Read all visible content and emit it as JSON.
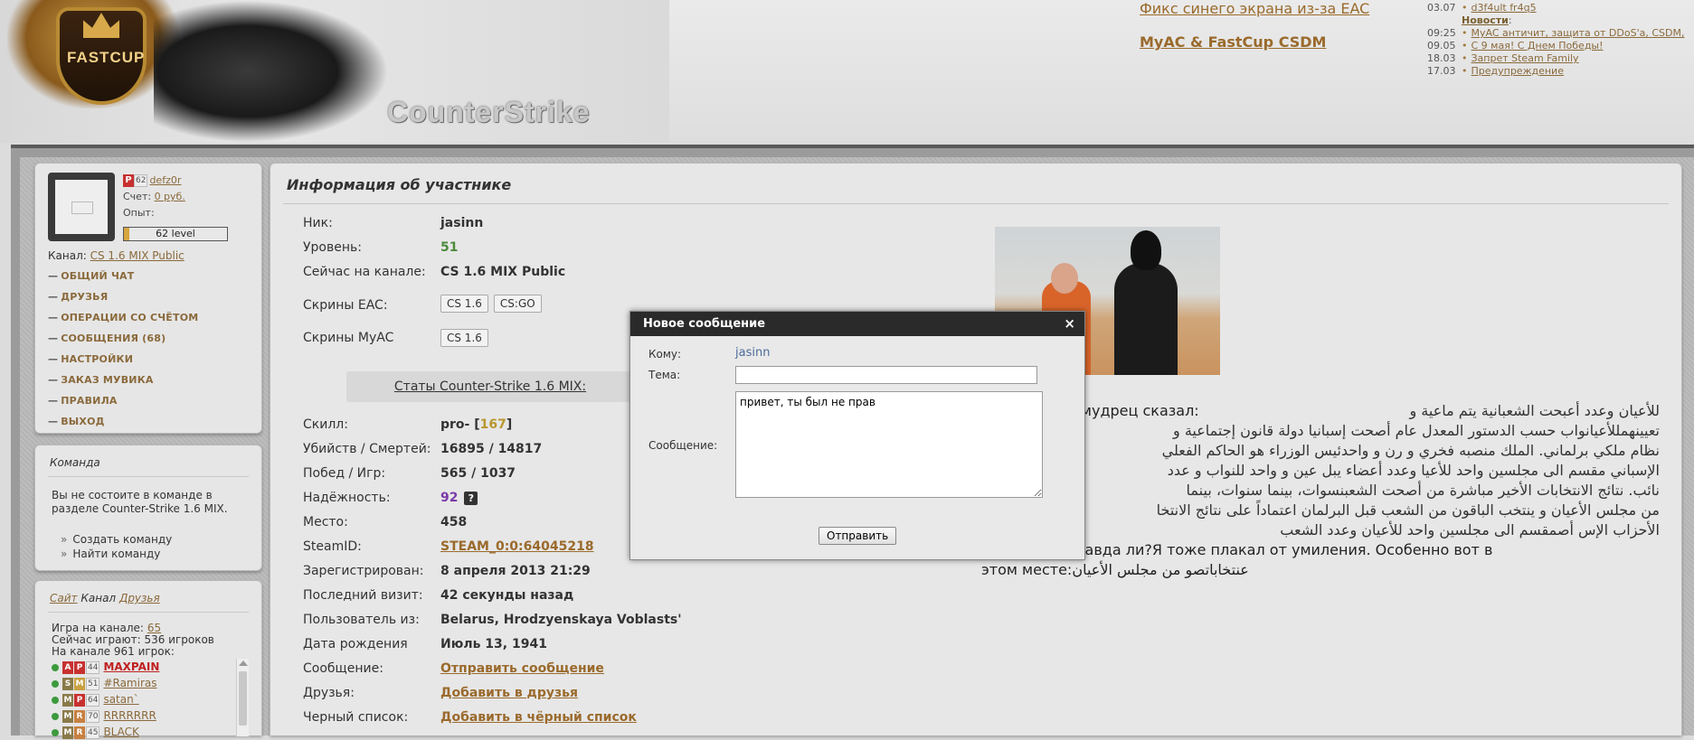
{
  "header": {
    "logo_text": "FASTCUP",
    "game_title": "CounterStrike",
    "big_links": [
      "Фикс синего экрана из-за EAC",
      "MyAC & FastCup CSDM"
    ],
    "top_item": {
      "date": "03.07",
      "label": "d3f4ult fr4q5"
    },
    "news_header": "Новости",
    "news": [
      {
        "date": "09:25",
        "label": "MyAC античит, защита от DDoS'a, CSDM,"
      },
      {
        "date": "09.05",
        "label": "С 9 мая! С Днем Победы!"
      },
      {
        "date": "18.03",
        "label": "Запрет Steam Family"
      },
      {
        "date": "17.03",
        "label": "Предупреждение"
      }
    ]
  },
  "user": {
    "rank_letter": "P",
    "rank_num": "62",
    "name": "defz0r",
    "balance_label": "Счет:",
    "balance_value": "0 руб.",
    "exp_label": "Опыт:",
    "level_text": "62 level",
    "level_progress": 0.05,
    "channel_label": "Канал:",
    "channel_value": "CS 1.6 MIX Public"
  },
  "menu": [
    "ОБЩИЙ ЧАТ",
    "ДРУЗЬЯ",
    "ОПЕРАЦИИ СО СЧЁТОМ",
    "СООБЩЕНИЯ (68)",
    "НАСТРОЙКИ",
    "ЗАКАЗ МУВИКА",
    "ПРАВИЛА",
    "ВЫХОД"
  ],
  "team": {
    "title": "Команда",
    "text": "Вы не состоите в команде в разделе Counter-Strike 1.6 MIX.",
    "links": [
      "Создать команду",
      "Найти команду"
    ]
  },
  "channel_panel": {
    "tab_site": "Сайт",
    "tab_channel": "Канал",
    "tab_friends": "Друзья",
    "game_label": "Игра на канале:",
    "game_count": "65",
    "playing_now": "Сейчас играют: 536 игроков",
    "on_channel": "На канале 961 игрок:",
    "players": [
      {
        "b1": "A",
        "b1c": "#c83030",
        "b2": "P",
        "b2c": "#c83030",
        "num": "44",
        "name": "MAXPAIN",
        "hot": true
      },
      {
        "b1": "S",
        "b1c": "#8a7a4a",
        "b2": "M",
        "b2c": "#c8a040",
        "num": "51",
        "name": "#Ramiras",
        "hot": false
      },
      {
        "b1": "M",
        "b1c": "#8a7a4a",
        "b2": "P",
        "b2c": "#c83030",
        "num": "64",
        "name": "satan`",
        "hot": false
      },
      {
        "b1": "M",
        "b1c": "#8a7a4a",
        "b2": "R",
        "b2c": "#c88040",
        "num": "70",
        "name": "RRRRRRR",
        "hot": false
      },
      {
        "b1": "M",
        "b1c": "#8a7a4a",
        "b2": "R",
        "b2c": "#c88040",
        "num": "45",
        "name": "BLACK",
        "hot": false
      }
    ]
  },
  "profile": {
    "title": "Информация об участнике",
    "rows": [
      {
        "label": "Ник:",
        "value": "jasinn"
      },
      {
        "label": "Уровень:",
        "value": "51"
      },
      {
        "label": "Сейчас на канале:",
        "value": "CS 1.6 MIX Public"
      }
    ],
    "eac_label": "Скрины EAC:",
    "eac_buttons": [
      "CS 1.6",
      "CS:GO"
    ],
    "myac_label": "Скрины MyAC",
    "myac_buttons": [
      "CS 1.6"
    ],
    "stats_link": "Статы Counter-Strike 1.6 MIX:",
    "skill_label": "Скилл:",
    "skill_rank": "pro-",
    "skill_value": "167",
    "kd_label": "Убийств / Смертей:",
    "kd_value": "16895 / 14817",
    "wins_label": "Побед / Игр:",
    "wins_value": "565 / 1037",
    "rel_label": "Надёжность:",
    "rel_value": "92",
    "rel_help": "?",
    "place_label": "Место:",
    "place_value": "458",
    "steam_label": "SteamID:",
    "steam_value": "STEAM_0:0:64045218",
    "reg_label": "Зарегистрирован:",
    "reg_value": "8 апреля 2013 21:29",
    "visit_label": "Последний визит:",
    "visit_value": "42 секунды назад",
    "from_label": "Пользователь из:",
    "from_value": "Belarus, Hrodzyenskaya Voblasts'",
    "bday_label": "Дата рождения",
    "bday_value": "Июль 13, 1941",
    "msg_label": "Сообщение:",
    "msg_link": "Отправить сообщение",
    "friends_label": "Друзья:",
    "friends_link": "Добавить в друзья",
    "black_label": "Черный список:",
    "black_link": "Добавить в чёрный список"
  },
  "bio": {
    "line1_ru": "ин арабский мудрец сказал:",
    "line1_ar": "للأعيان وعدد أعبحت الشعبانية يتم ماعية و",
    "ar_lines": [
      "تعيينهمللأعيانواب حسب الدستور المعدل عام أصحت إسبانيا دولة قانون إجتماعية و",
      "نظام ملكي برلماني. الملك منصبه فخري و رن و واحدئيس الوزراء هو الحاكم الفعلي",
      "الإسباني مقسم الى مجلسين واحد للأعيا وعدد أعضاء يبل عين و واحد للنواب و عدد",
      "نائب. نتائج الانتخابات الأخير مباشرة من أصحت الشعبنسوات، بينما سنوات، بينما",
      "من مجلس الأعيان و ينتخب الباقون من الشعب قبل البرلمان اعتماداً على نتائج الانتخا",
      "الأحزاب الإس أصمقسم الى مجلسين واحد للأعيان وعدد الشعب"
    ],
    "line_end_ru": "расиво, не правда ли?Я тоже плакал от умиления. Особенно вот в",
    "line_last_ru": "этом месте:",
    "line_last_ar": "عنتخاباتصو من مجلس الأعيان"
  },
  "modal": {
    "title": "Новое сообщение",
    "close": "×",
    "to_label": "Кому:",
    "to_value": "jasinn",
    "subject_label": "Тема:",
    "subject_value": "",
    "message_label": "Сообщение:",
    "message_value": "привет, ты был не прав",
    "send_label": "Отправить"
  }
}
